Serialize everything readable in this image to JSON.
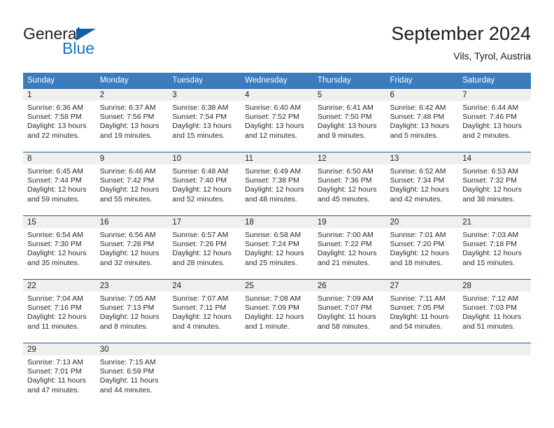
{
  "brand": {
    "name_top": "General",
    "name_bottom": "Blue",
    "color_blue": "#1b74c4",
    "triangle_color": "#1060a8"
  },
  "header": {
    "title": "September 2024",
    "location": "Vils, Tyrol, Austria"
  },
  "theme": {
    "header_row_bg": "#3a7cbe",
    "header_row_text": "#ffffff",
    "cell_border": "#1b5fa0",
    "daynum_band_bg": "#efefef"
  },
  "weekdays": [
    "Sunday",
    "Monday",
    "Tuesday",
    "Wednesday",
    "Thursday",
    "Friday",
    "Saturday"
  ],
  "labels": {
    "sunrise_prefix": "Sunrise:",
    "sunset_prefix": "Sunset:",
    "daylight_prefix": "Daylight:"
  },
  "weeks": [
    [
      {
        "day": "1",
        "sunrise": "Sunrise: 6:36 AM",
        "sunset": "Sunset: 7:58 PM",
        "daylight_1": "Daylight: 13 hours",
        "daylight_2": "and 22 minutes."
      },
      {
        "day": "2",
        "sunrise": "Sunrise: 6:37 AM",
        "sunset": "Sunset: 7:56 PM",
        "daylight_1": "Daylight: 13 hours",
        "daylight_2": "and 19 minutes."
      },
      {
        "day": "3",
        "sunrise": "Sunrise: 6:38 AM",
        "sunset": "Sunset: 7:54 PM",
        "daylight_1": "Daylight: 13 hours",
        "daylight_2": "and 15 minutes."
      },
      {
        "day": "4",
        "sunrise": "Sunrise: 6:40 AM",
        "sunset": "Sunset: 7:52 PM",
        "daylight_1": "Daylight: 13 hours",
        "daylight_2": "and 12 minutes."
      },
      {
        "day": "5",
        "sunrise": "Sunrise: 6:41 AM",
        "sunset": "Sunset: 7:50 PM",
        "daylight_1": "Daylight: 13 hours",
        "daylight_2": "and 9 minutes."
      },
      {
        "day": "6",
        "sunrise": "Sunrise: 6:42 AM",
        "sunset": "Sunset: 7:48 PM",
        "daylight_1": "Daylight: 13 hours",
        "daylight_2": "and 5 minutes."
      },
      {
        "day": "7",
        "sunrise": "Sunrise: 6:44 AM",
        "sunset": "Sunset: 7:46 PM",
        "daylight_1": "Daylight: 13 hours",
        "daylight_2": "and 2 minutes."
      }
    ],
    [
      {
        "day": "8",
        "sunrise": "Sunrise: 6:45 AM",
        "sunset": "Sunset: 7:44 PM",
        "daylight_1": "Daylight: 12 hours",
        "daylight_2": "and 59 minutes."
      },
      {
        "day": "9",
        "sunrise": "Sunrise: 6:46 AM",
        "sunset": "Sunset: 7:42 PM",
        "daylight_1": "Daylight: 12 hours",
        "daylight_2": "and 55 minutes."
      },
      {
        "day": "10",
        "sunrise": "Sunrise: 6:48 AM",
        "sunset": "Sunset: 7:40 PM",
        "daylight_1": "Daylight: 12 hours",
        "daylight_2": "and 52 minutes."
      },
      {
        "day": "11",
        "sunrise": "Sunrise: 6:49 AM",
        "sunset": "Sunset: 7:38 PM",
        "daylight_1": "Daylight: 12 hours",
        "daylight_2": "and 48 minutes."
      },
      {
        "day": "12",
        "sunrise": "Sunrise: 6:50 AM",
        "sunset": "Sunset: 7:36 PM",
        "daylight_1": "Daylight: 12 hours",
        "daylight_2": "and 45 minutes."
      },
      {
        "day": "13",
        "sunrise": "Sunrise: 6:52 AM",
        "sunset": "Sunset: 7:34 PM",
        "daylight_1": "Daylight: 12 hours",
        "daylight_2": "and 42 minutes."
      },
      {
        "day": "14",
        "sunrise": "Sunrise: 6:53 AM",
        "sunset": "Sunset: 7:32 PM",
        "daylight_1": "Daylight: 12 hours",
        "daylight_2": "and 38 minutes."
      }
    ],
    [
      {
        "day": "15",
        "sunrise": "Sunrise: 6:54 AM",
        "sunset": "Sunset: 7:30 PM",
        "daylight_1": "Daylight: 12 hours",
        "daylight_2": "and 35 minutes."
      },
      {
        "day": "16",
        "sunrise": "Sunrise: 6:56 AM",
        "sunset": "Sunset: 7:28 PM",
        "daylight_1": "Daylight: 12 hours",
        "daylight_2": "and 32 minutes."
      },
      {
        "day": "17",
        "sunrise": "Sunrise: 6:57 AM",
        "sunset": "Sunset: 7:26 PM",
        "daylight_1": "Daylight: 12 hours",
        "daylight_2": "and 28 minutes."
      },
      {
        "day": "18",
        "sunrise": "Sunrise: 6:58 AM",
        "sunset": "Sunset: 7:24 PM",
        "daylight_1": "Daylight: 12 hours",
        "daylight_2": "and 25 minutes."
      },
      {
        "day": "19",
        "sunrise": "Sunrise: 7:00 AM",
        "sunset": "Sunset: 7:22 PM",
        "daylight_1": "Daylight: 12 hours",
        "daylight_2": "and 21 minutes."
      },
      {
        "day": "20",
        "sunrise": "Sunrise: 7:01 AM",
        "sunset": "Sunset: 7:20 PM",
        "daylight_1": "Daylight: 12 hours",
        "daylight_2": "and 18 minutes."
      },
      {
        "day": "21",
        "sunrise": "Sunrise: 7:03 AM",
        "sunset": "Sunset: 7:18 PM",
        "daylight_1": "Daylight: 12 hours",
        "daylight_2": "and 15 minutes."
      }
    ],
    [
      {
        "day": "22",
        "sunrise": "Sunrise: 7:04 AM",
        "sunset": "Sunset: 7:16 PM",
        "daylight_1": "Daylight: 12 hours",
        "daylight_2": "and 11 minutes."
      },
      {
        "day": "23",
        "sunrise": "Sunrise: 7:05 AM",
        "sunset": "Sunset: 7:13 PM",
        "daylight_1": "Daylight: 12 hours",
        "daylight_2": "and 8 minutes."
      },
      {
        "day": "24",
        "sunrise": "Sunrise: 7:07 AM",
        "sunset": "Sunset: 7:11 PM",
        "daylight_1": "Daylight: 12 hours",
        "daylight_2": "and 4 minutes."
      },
      {
        "day": "25",
        "sunrise": "Sunrise: 7:08 AM",
        "sunset": "Sunset: 7:09 PM",
        "daylight_1": "Daylight: 12 hours",
        "daylight_2": "and 1 minute."
      },
      {
        "day": "26",
        "sunrise": "Sunrise: 7:09 AM",
        "sunset": "Sunset: 7:07 PM",
        "daylight_1": "Daylight: 11 hours",
        "daylight_2": "and 58 minutes."
      },
      {
        "day": "27",
        "sunrise": "Sunrise: 7:11 AM",
        "sunset": "Sunset: 7:05 PM",
        "daylight_1": "Daylight: 11 hours",
        "daylight_2": "and 54 minutes."
      },
      {
        "day": "28",
        "sunrise": "Sunrise: 7:12 AM",
        "sunset": "Sunset: 7:03 PM",
        "daylight_1": "Daylight: 11 hours",
        "daylight_2": "and 51 minutes."
      }
    ],
    [
      {
        "day": "29",
        "sunrise": "Sunrise: 7:13 AM",
        "sunset": "Sunset: 7:01 PM",
        "daylight_1": "Daylight: 11 hours",
        "daylight_2": "and 47 minutes."
      },
      {
        "day": "30",
        "sunrise": "Sunrise: 7:15 AM",
        "sunset": "Sunset: 6:59 PM",
        "daylight_1": "Daylight: 11 hours",
        "daylight_2": "and 44 minutes."
      },
      {
        "day": "",
        "sunrise": "",
        "sunset": "",
        "daylight_1": "",
        "daylight_2": ""
      },
      {
        "day": "",
        "sunrise": "",
        "sunset": "",
        "daylight_1": "",
        "daylight_2": ""
      },
      {
        "day": "",
        "sunrise": "",
        "sunset": "",
        "daylight_1": "",
        "daylight_2": ""
      },
      {
        "day": "",
        "sunrise": "",
        "sunset": "",
        "daylight_1": "",
        "daylight_2": ""
      },
      {
        "day": "",
        "sunrise": "",
        "sunset": "",
        "daylight_1": "",
        "daylight_2": ""
      }
    ]
  ]
}
